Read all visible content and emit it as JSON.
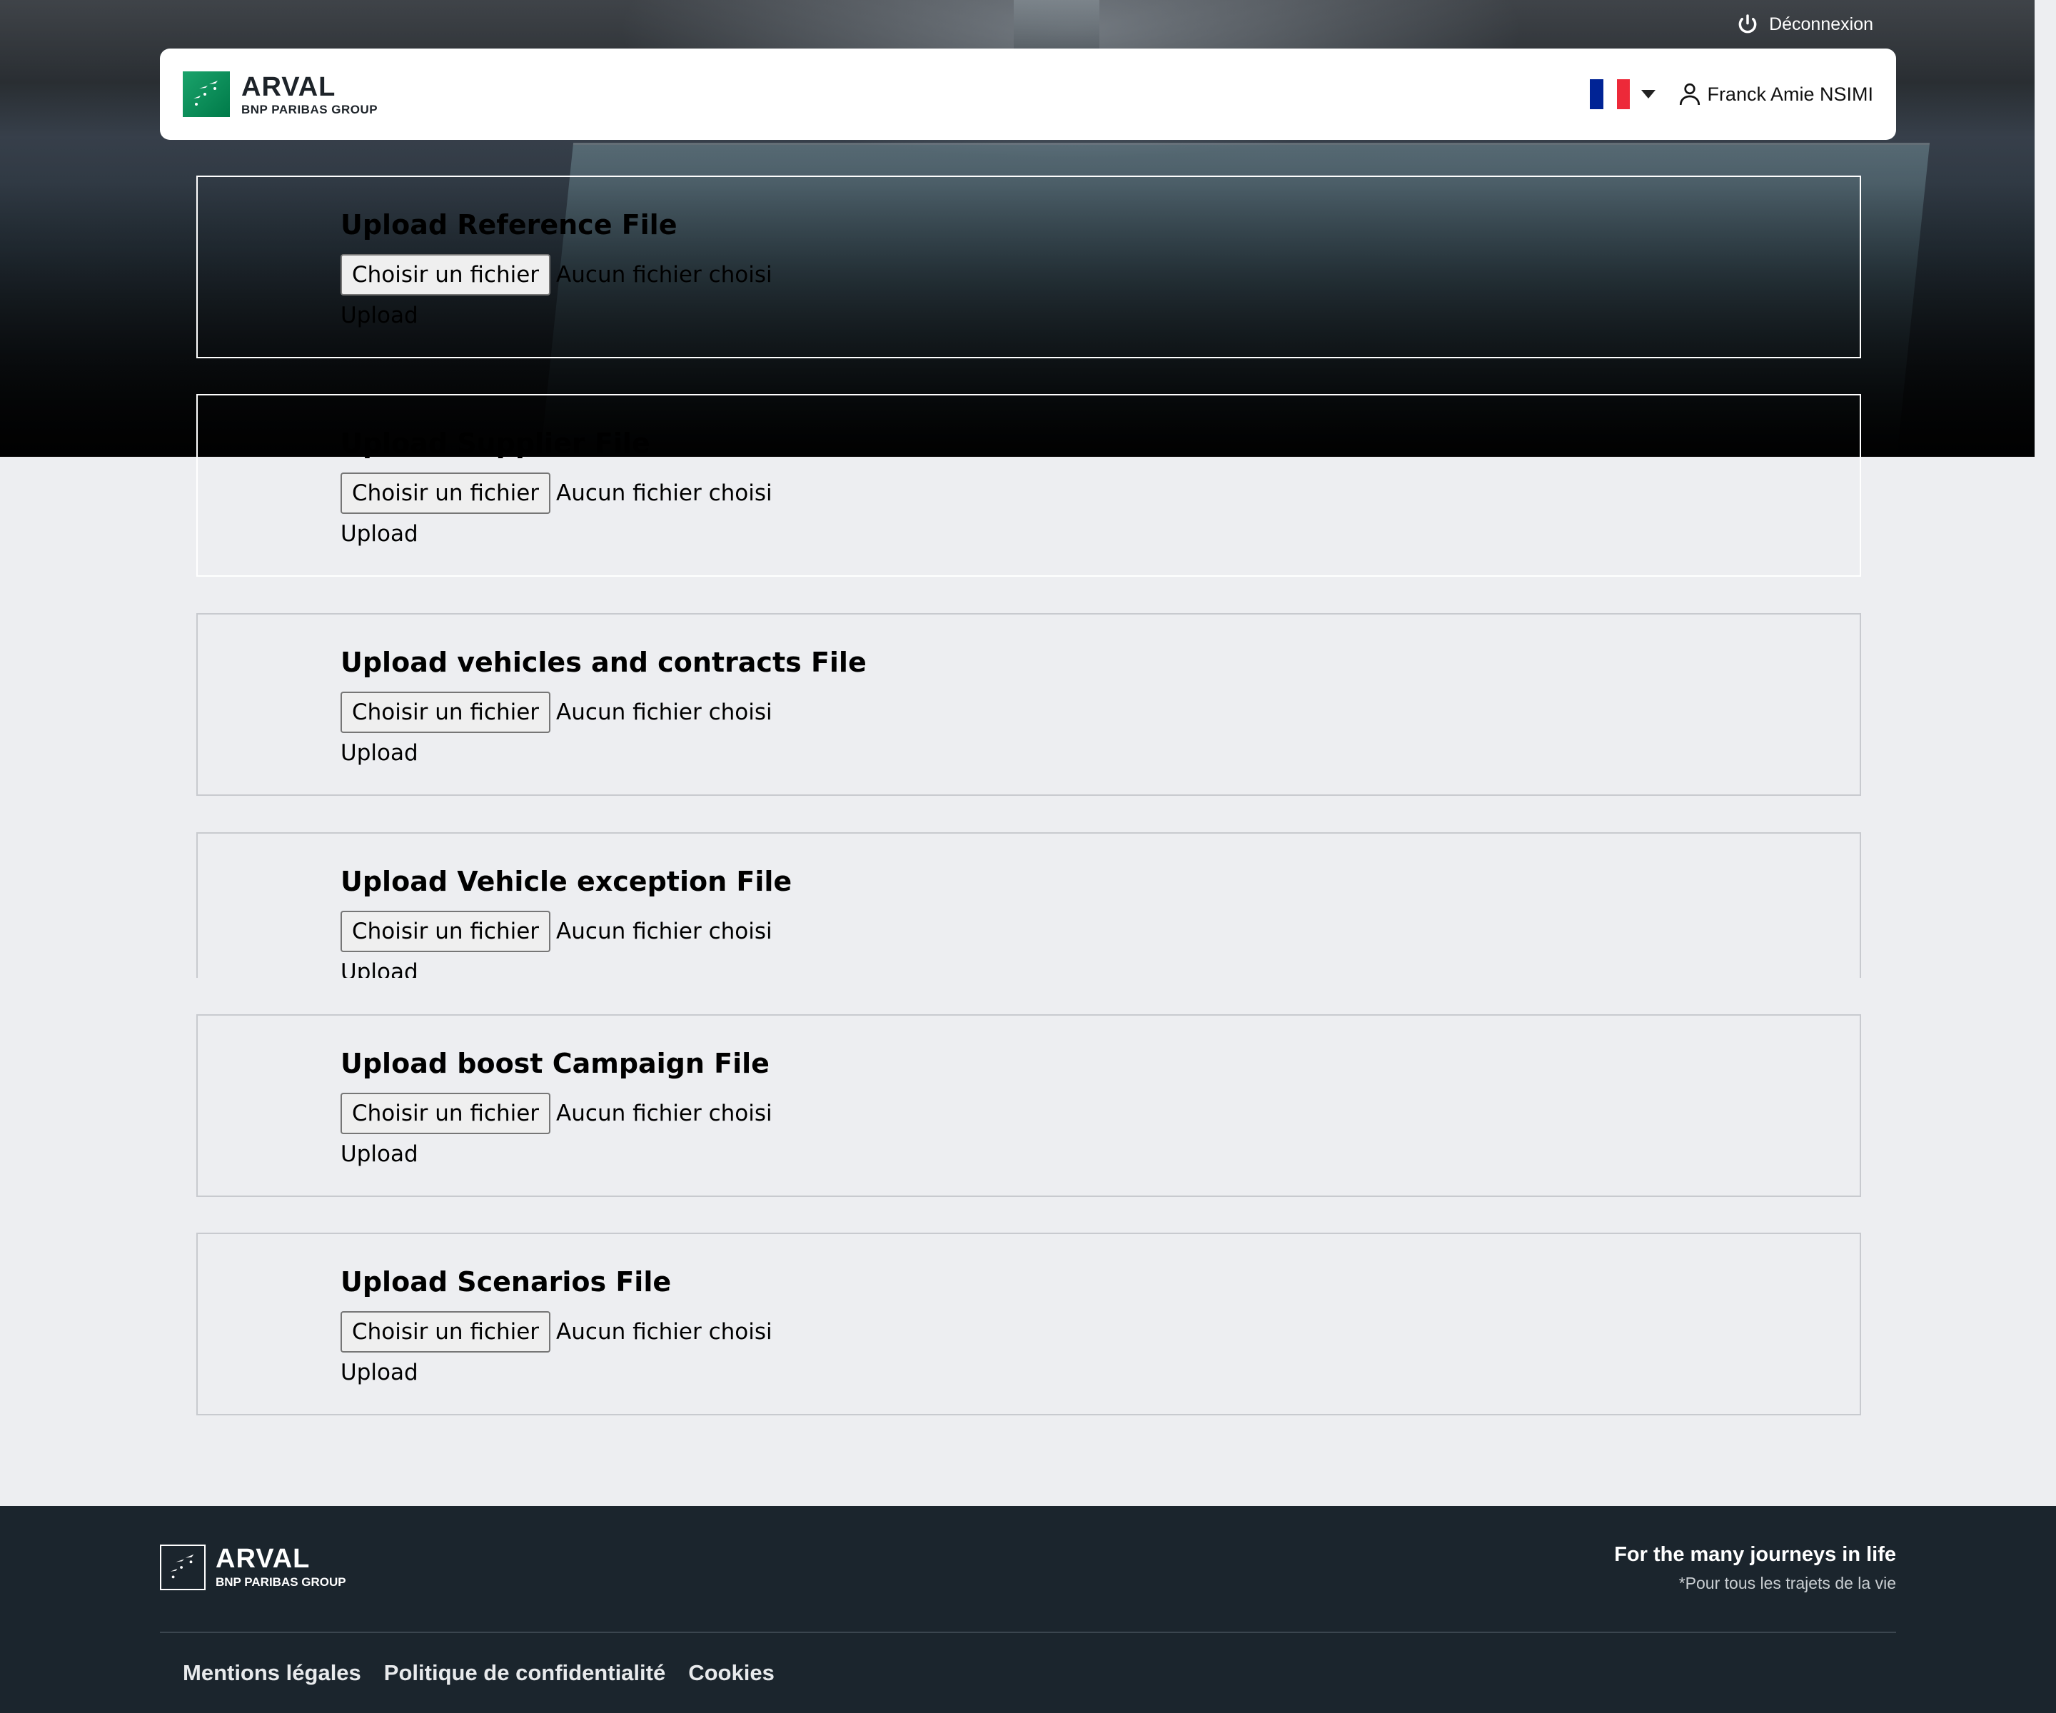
{
  "colors": {
    "page_bg": "#edeef1",
    "header_bg": "#ffffff",
    "footer_bg": "#1b252d",
    "brand_green": "#00915a",
    "flag_blue": "#002395",
    "flag_white": "#ffffff",
    "flag_red": "#ed2939"
  },
  "topbar": {
    "logout_label": "Déconnexion",
    "logout_icon": "power-icon"
  },
  "header": {
    "brand_name": "ARVAL",
    "brand_group": "BNP PARIBAS GROUP",
    "language": "FR",
    "user_name": "Franck Amie NSIMI",
    "user_icon": "user-icon"
  },
  "cards": [
    {
      "title": "Upload Reference File",
      "choose_label": "Choisir un fichier",
      "file_status": "Aucun fichier choisi",
      "upload_label": "Upload"
    },
    {
      "title": "Upload Supplier File",
      "choose_label": "Choisir un fichier",
      "file_status": "Aucun fichier choisi",
      "upload_label": "Upload"
    },
    {
      "title": "Upload vehicles and contracts File",
      "choose_label": "Choisir un fichier",
      "file_status": "Aucun fichier choisi",
      "upload_label": "Upload"
    },
    {
      "title": "Upload Vehicle exception File",
      "choose_label": "Choisir un fichier",
      "file_status": "Aucun fichier choisi",
      "upload_label": "Upload"
    },
    {
      "title": "Upload boost Campaign File",
      "choose_label": "Choisir un fichier",
      "file_status": "Aucun fichier choisi",
      "upload_label": "Upload"
    },
    {
      "title": "Upload Scenarios File",
      "choose_label": "Choisir un fichier",
      "file_status": "Aucun fichier choisi",
      "upload_label": "Upload"
    }
  ],
  "footer": {
    "brand_name": "ARVAL",
    "brand_group": "BNP PARIBAS GROUP",
    "tagline": "For the many journeys in life",
    "tagline_sub": "*Pour tous les trajets de la vie",
    "links": [
      "Mentions légales",
      "Politique de confidentialité",
      "Cookies"
    ]
  }
}
